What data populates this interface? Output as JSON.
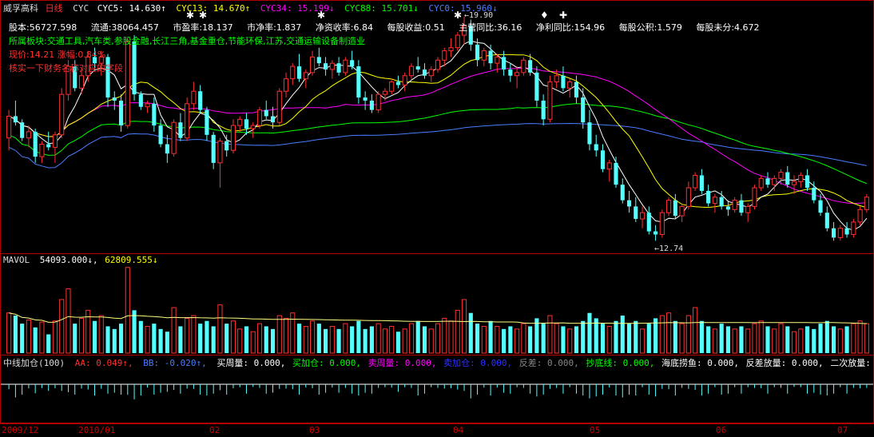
{
  "header": {
    "stock_name": "威孚高科",
    "period": "日线",
    "indicator": "CYC",
    "items": [
      {
        "label": "CYC5: 14.630↑",
        "color": "#ffffff"
      },
      {
        "label": "CYC13: 14.670↑",
        "color": "#ffff00"
      },
      {
        "label": "CYC34: 15.199↓",
        "color": "#ff00ff"
      },
      {
        "label": "CYC88: 15.701↓",
        "color": "#00ff00"
      },
      {
        "label": "CYC0: 15.960↓",
        "color": "#4a7cff"
      }
    ]
  },
  "info": {
    "row1": [
      "股本:56727.598",
      "流通:38064.457",
      "市盈率:18.137",
      "市净率:1.837",
      "净资收率:6.84",
      "每股收益:0.51",
      "主营同比:36.16",
      "净利同比:154.96",
      "每股公积:1.579",
      "每股未分:4.672"
    ],
    "row2": "所属板块:交通工具,汽车类,参股金融,长江三角,基金重仓,节能环保,江苏,交通运输设备制造业",
    "row3": "现价:14.21  涨幅:0.84%",
    "row4": "核实一下财务名称对应的字段"
  },
  "annotations": {
    "high_label": "19.90",
    "low_label": "12.74"
  },
  "volume": {
    "title": "MAVOL",
    "ma1": "54093.000↓,",
    "ma2": "62809.555↓"
  },
  "indicator_panel": {
    "title": "中线加仓(100)",
    "items": [
      {
        "label": "AA: 0.049↑,",
        "color": "#ff3030"
      },
      {
        "label": "BB: -0.020↑,",
        "color": "#4a7cff"
      },
      {
        "label": "买周量: 0.000,",
        "color": "#ffffff"
      },
      {
        "label": "买加仓: 0.000,",
        "color": "#00ff00"
      },
      {
        "label": "卖周量: 0.000,",
        "color": "#ff00ff"
      },
      {
        "label": "卖加仓: 0.000,",
        "color": "#3030ff"
      },
      {
        "label": "反差: 0.000,",
        "color": "#888888"
      },
      {
        "label": "抄底线: 0.000,",
        "color": "#00ff00"
      },
      {
        "label": "海底捞鱼: 0.000,",
        "color": "#ffffff"
      },
      {
        "label": "反差放量: 0.000,",
        "color": "#ffffff"
      },
      {
        "label": "二次放量: 0.000",
        "color": "#ffffff"
      }
    ]
  },
  "dates": [
    "2009/12",
    "2010/01",
    "02",
    "03",
    "04",
    "05",
    "06",
    "07"
  ],
  "chart_data": {
    "type": "candlestick",
    "y_range": [
      12.4,
      20.2
    ],
    "candles": [
      [
        16.0,
        16.9,
        15.6,
        16.7
      ],
      [
        16.7,
        17.2,
        16.4,
        16.5
      ],
      [
        16.5,
        16.6,
        15.9,
        16.0
      ],
      [
        16.0,
        16.4,
        15.7,
        16.2
      ],
      [
        16.2,
        16.3,
        15.2,
        15.4
      ],
      [
        15.4,
        15.9,
        15.2,
        15.8
      ],
      [
        15.8,
        16.2,
        15.6,
        15.7
      ],
      [
        15.7,
        16.2,
        15.2,
        16.1
      ],
      [
        16.1,
        17.6,
        16.0,
        17.4
      ],
      [
        17.4,
        18.5,
        17.2,
        18.3
      ],
      [
        18.3,
        18.5,
        17.5,
        17.6
      ],
      [
        17.6,
        18.2,
        17.4,
        18.0
      ],
      [
        18.0,
        18.8,
        17.8,
        18.6
      ],
      [
        18.6,
        18.9,
        18.2,
        18.4
      ],
      [
        18.4,
        18.8,
        18.0,
        18.6
      ],
      [
        18.6,
        18.7,
        17.0,
        17.3
      ],
      [
        17.3,
        17.5,
        16.9,
        17.2
      ],
      [
        17.2,
        17.4,
        16.2,
        16.4
      ],
      [
        16.4,
        19.2,
        16.3,
        19.1
      ],
      [
        19.1,
        19.3,
        17.2,
        17.4
      ],
      [
        17.4,
        17.5,
        16.9,
        17.0
      ],
      [
        17.0,
        17.2,
        16.8,
        17.1
      ],
      [
        17.1,
        17.3,
        16.2,
        16.4
      ],
      [
        16.4,
        16.6,
        15.7,
        15.8
      ],
      [
        15.8,
        16.1,
        15.2,
        15.5
      ],
      [
        15.5,
        16.6,
        15.4,
        16.5
      ],
      [
        16.5,
        16.8,
        15.9,
        16.0
      ],
      [
        16.0,
        17.3,
        15.9,
        17.1
      ],
      [
        17.1,
        17.8,
        16.9,
        17.5
      ],
      [
        17.5,
        17.7,
        16.8,
        16.9
      ],
      [
        16.9,
        17.0,
        15.9,
        16.1
      ],
      [
        16.1,
        16.2,
        15.0,
        15.2
      ],
      [
        15.2,
        16.0,
        14.4,
        15.9
      ],
      [
        15.9,
        16.1,
        15.4,
        15.6
      ],
      [
        15.6,
        16.6,
        15.5,
        16.4
      ],
      [
        16.4,
        16.7,
        16.2,
        16.6
      ],
      [
        16.6,
        16.8,
        16.1,
        16.3
      ],
      [
        16.3,
        16.5,
        16.0,
        16.4
      ],
      [
        16.4,
        17.0,
        16.3,
        16.9
      ],
      [
        16.9,
        17.2,
        16.6,
        16.7
      ],
      [
        16.7,
        17.0,
        16.3,
        16.5
      ],
      [
        16.5,
        17.6,
        16.4,
        17.5
      ],
      [
        17.5,
        18.1,
        17.3,
        17.9
      ],
      [
        17.9,
        18.4,
        17.7,
        18.3
      ],
      [
        18.3,
        18.7,
        17.8,
        17.9
      ],
      [
        17.9,
        18.2,
        17.6,
        18.1
      ],
      [
        18.1,
        18.8,
        18.0,
        18.6
      ],
      [
        18.6,
        18.9,
        18.3,
        18.4
      ],
      [
        18.4,
        18.6,
        18.0,
        18.2
      ],
      [
        18.2,
        18.5,
        17.9,
        18.4
      ],
      [
        18.4,
        18.6,
        18.0,
        18.1
      ],
      [
        18.1,
        18.6,
        18.0,
        18.5
      ],
      [
        18.5,
        18.8,
        18.2,
        18.3
      ],
      [
        18.3,
        18.5,
        17.1,
        17.3
      ],
      [
        17.3,
        17.5,
        16.9,
        17.2
      ],
      [
        17.2,
        17.4,
        16.8,
        16.9
      ],
      [
        16.9,
        17.5,
        16.8,
        17.4
      ],
      [
        17.4,
        17.6,
        17.2,
        17.5
      ],
      [
        17.5,
        17.9,
        17.4,
        17.8
      ],
      [
        17.8,
        18.0,
        17.6,
        17.7
      ],
      [
        17.7,
        18.1,
        17.5,
        18.0
      ],
      [
        18.0,
        18.4,
        17.9,
        18.3
      ],
      [
        18.3,
        18.6,
        18.1,
        18.2
      ],
      [
        18.2,
        18.4,
        17.9,
        18.0
      ],
      [
        18.0,
        18.3,
        17.8,
        18.2
      ],
      [
        18.2,
        18.6,
        18.1,
        18.5
      ],
      [
        18.5,
        18.9,
        18.3,
        18.8
      ],
      [
        18.8,
        19.2,
        18.6,
        18.9
      ],
      [
        18.9,
        19.4,
        18.8,
        19.3
      ],
      [
        19.3,
        19.9,
        19.0,
        19.6
      ],
      [
        19.6,
        19.8,
        18.8,
        19.0
      ],
      [
        19.0,
        19.2,
        18.3,
        18.5
      ],
      [
        18.5,
        18.9,
        18.3,
        18.8
      ],
      [
        18.8,
        19.0,
        18.2,
        18.4
      ],
      [
        18.4,
        18.7,
        18.1,
        18.6
      ],
      [
        18.6,
        18.8,
        18.0,
        18.2
      ],
      [
        18.2,
        18.4,
        17.8,
        18.0
      ],
      [
        18.0,
        18.3,
        17.6,
        18.1
      ],
      [
        18.1,
        18.6,
        18.0,
        18.5
      ],
      [
        18.5,
        18.7,
        18.0,
        18.1
      ],
      [
        18.1,
        18.3,
        17.0,
        17.2
      ],
      [
        17.2,
        17.4,
        16.4,
        16.6
      ],
      [
        16.6,
        18.0,
        16.5,
        17.8
      ],
      [
        17.8,
        18.2,
        17.6,
        18.0
      ],
      [
        18.0,
        18.3,
        17.5,
        17.6
      ],
      [
        17.6,
        17.9,
        17.3,
        17.8
      ],
      [
        17.8,
        18.0,
        17.1,
        17.3
      ],
      [
        17.3,
        17.6,
        16.3,
        16.5
      ],
      [
        16.5,
        16.9,
        15.6,
        15.8
      ],
      [
        15.8,
        16.1,
        15.4,
        15.6
      ],
      [
        15.6,
        15.8,
        14.9,
        15.0
      ],
      [
        15.0,
        15.3,
        14.6,
        15.2
      ],
      [
        15.2,
        15.4,
        14.4,
        14.5
      ],
      [
        14.5,
        14.7,
        13.9,
        14.0
      ],
      [
        14.0,
        14.3,
        13.6,
        13.8
      ],
      [
        13.8,
        14.1,
        13.3,
        13.4
      ],
      [
        13.4,
        13.8,
        13.1,
        13.6
      ],
      [
        13.6,
        13.8,
        12.9,
        13.0
      ],
      [
        13.0,
        13.2,
        12.7,
        12.9
      ],
      [
        12.9,
        13.7,
        12.8,
        13.6
      ],
      [
        13.6,
        14.1,
        13.5,
        14.0
      ],
      [
        14.0,
        14.2,
        13.4,
        13.5
      ],
      [
        13.5,
        13.9,
        13.3,
        13.8
      ],
      [
        13.8,
        14.6,
        13.7,
        14.4
      ],
      [
        14.4,
        14.9,
        14.3,
        14.8
      ],
      [
        14.8,
        15.0,
        14.2,
        14.3
      ],
      [
        14.3,
        14.5,
        13.8,
        13.9
      ],
      [
        13.9,
        14.2,
        13.6,
        14.1
      ],
      [
        14.1,
        14.3,
        13.7,
        13.8
      ],
      [
        13.8,
        14.0,
        13.5,
        13.7
      ],
      [
        13.7,
        14.1,
        13.6,
        14.0
      ],
      [
        14.0,
        14.2,
        13.5,
        13.6
      ],
      [
        13.6,
        13.9,
        13.3,
        13.8
      ],
      [
        13.8,
        14.5,
        13.7,
        14.4
      ],
      [
        14.4,
        14.8,
        14.3,
        14.7
      ],
      [
        14.7,
        14.9,
        14.4,
        14.5
      ],
      [
        14.5,
        14.8,
        14.3,
        14.7
      ],
      [
        14.7,
        15.0,
        14.5,
        14.9
      ],
      [
        14.9,
        15.1,
        14.4,
        14.5
      ],
      [
        14.5,
        14.8,
        14.2,
        14.6
      ],
      [
        14.6,
        14.9,
        14.4,
        14.8
      ],
      [
        14.8,
        15.0,
        14.3,
        14.4
      ],
      [
        14.4,
        14.6,
        13.9,
        14.0
      ],
      [
        14.0,
        14.2,
        13.5,
        13.6
      ],
      [
        13.6,
        13.8,
        13.0,
        13.1
      ],
      [
        13.1,
        13.3,
        12.7,
        12.8
      ],
      [
        12.8,
        13.2,
        12.7,
        13.1
      ],
      [
        13.1,
        13.3,
        12.8,
        12.9
      ],
      [
        12.9,
        13.4,
        12.8,
        13.3
      ],
      [
        13.3,
        13.8,
        13.2,
        13.7
      ],
      [
        13.7,
        14.2,
        13.6,
        14.1
      ]
    ],
    "volumes": [
      75,
      70,
      55,
      62,
      48,
      58,
      35,
      60,
      100,
      120,
      55,
      65,
      80,
      60,
      70,
      50,
      45,
      55,
      160,
      80,
      60,
      50,
      55,
      45,
      40,
      85,
      50,
      65,
      70,
      55,
      60,
      50,
      90,
      55,
      60,
      45,
      50,
      40,
      55,
      50,
      45,
      70,
      65,
      75,
      55,
      50,
      60,
      55,
      45,
      50,
      45,
      55,
      50,
      60,
      45,
      50,
      55,
      45,
      50,
      40,
      45,
      55,
      60,
      50,
      45,
      55,
      65,
      60,
      80,
      100,
      75,
      55,
      50,
      60,
      50,
      45,
      50,
      45,
      55,
      50,
      65,
      55,
      70,
      55,
      50,
      45,
      50,
      60,
      75,
      65,
      55,
      50,
      60,
      70,
      55,
      60,
      45,
      55,
      65,
      70,
      75,
      60,
      55,
      70,
      85,
      60,
      50,
      45,
      55,
      50,
      45,
      50,
      45,
      55,
      60,
      50,
      45,
      55,
      50,
      40,
      45,
      50,
      45,
      55,
      60,
      50,
      45,
      50,
      55,
      60,
      55
    ]
  }
}
